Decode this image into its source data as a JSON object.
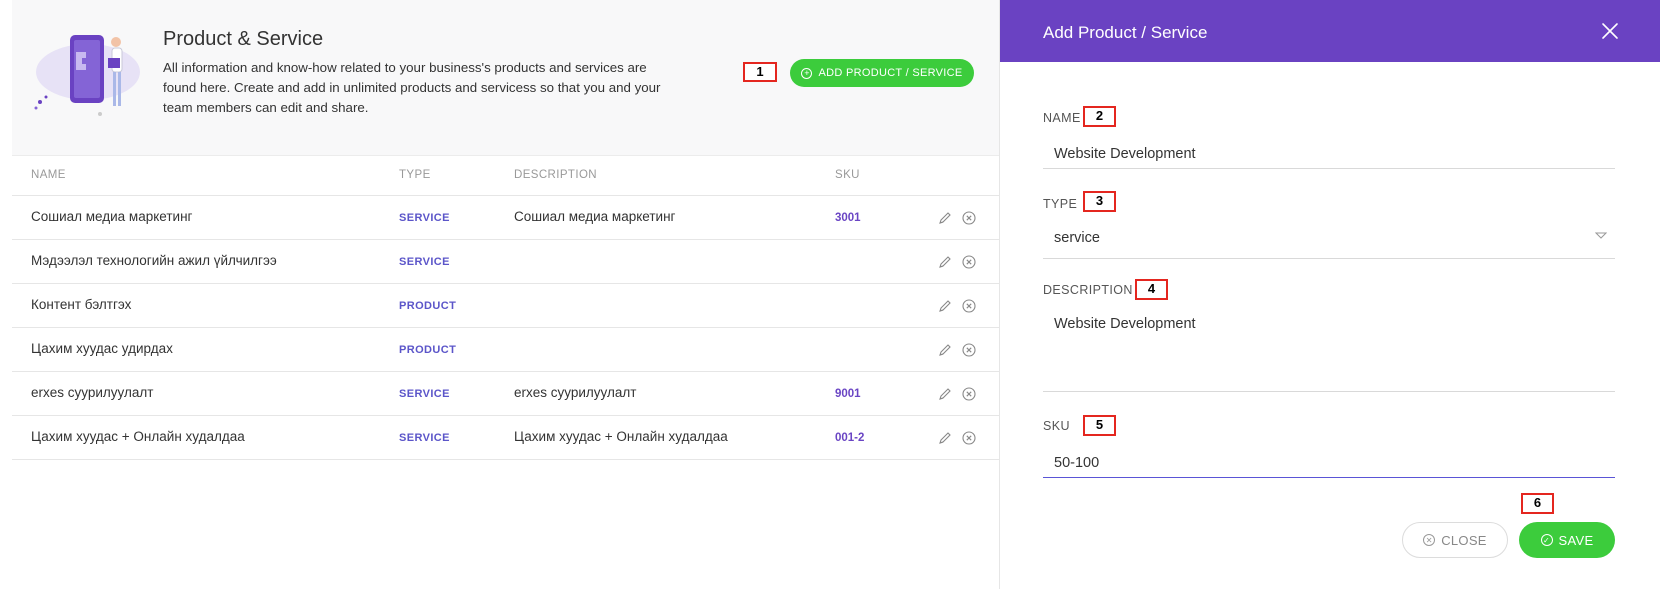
{
  "header": {
    "title": "Product & Service",
    "description": "All information and know-how related to your business's products and services are found here. Create and add in unlimited products and servicess so that you and your team members can edit and share.",
    "add_button_label": "ADD PRODUCT / SERVICE"
  },
  "table": {
    "columns": {
      "name": "NAME",
      "type": "TYPE",
      "description": "DESCRIPTION",
      "sku": "SKU"
    },
    "rows": [
      {
        "name": "Сошиал медиа маркетинг",
        "type": "SERVICE",
        "description": "Сошиал медиа маркетинг",
        "sku": "3001"
      },
      {
        "name": "Мэдээлэл технологийн ажил үйлчилгээ",
        "type": "SERVICE",
        "description": "",
        "sku": ""
      },
      {
        "name": "Контент бэлтгэх",
        "type": "PRODUCT",
        "description": "",
        "sku": ""
      },
      {
        "name": "Цахим хуудас удирдах",
        "type": "PRODUCT",
        "description": "",
        "sku": ""
      },
      {
        "name": "erxes суурилуулалт",
        "type": "SERVICE",
        "description": "erxes суурилуулалт",
        "sku": "9001"
      },
      {
        "name": "Цахим хуудас + Онлайн худалдаа",
        "type": "SERVICE",
        "description": "Цахим хуудас + Онлайн худалдаа",
        "sku": "001-2"
      }
    ]
  },
  "panel": {
    "title": "Add Product / Service",
    "name_label": "NAME",
    "name_value": "Website Development",
    "type_label": "TYPE",
    "type_value": "service",
    "description_label": "DESCRIPTION",
    "description_value": "Website Development",
    "sku_label": "SKU",
    "sku_value": "50-100",
    "close_label": "CLOSE",
    "save_label": "SAVE"
  },
  "callouts": [
    "1",
    "2",
    "3",
    "4",
    "5",
    "6"
  ],
  "colors": {
    "accent_purple": "#6a42c2",
    "success_green": "#3ccc3c",
    "type_text": "#5b55c9",
    "callout_border": "#e4261f"
  },
  "icons": [
    "puzzle-illustration",
    "plus-circle-icon",
    "edit-pencil-icon",
    "remove-circle-icon",
    "close-x-icon",
    "caret-down-icon",
    "x-circle-icon",
    "check-circle-icon"
  ]
}
